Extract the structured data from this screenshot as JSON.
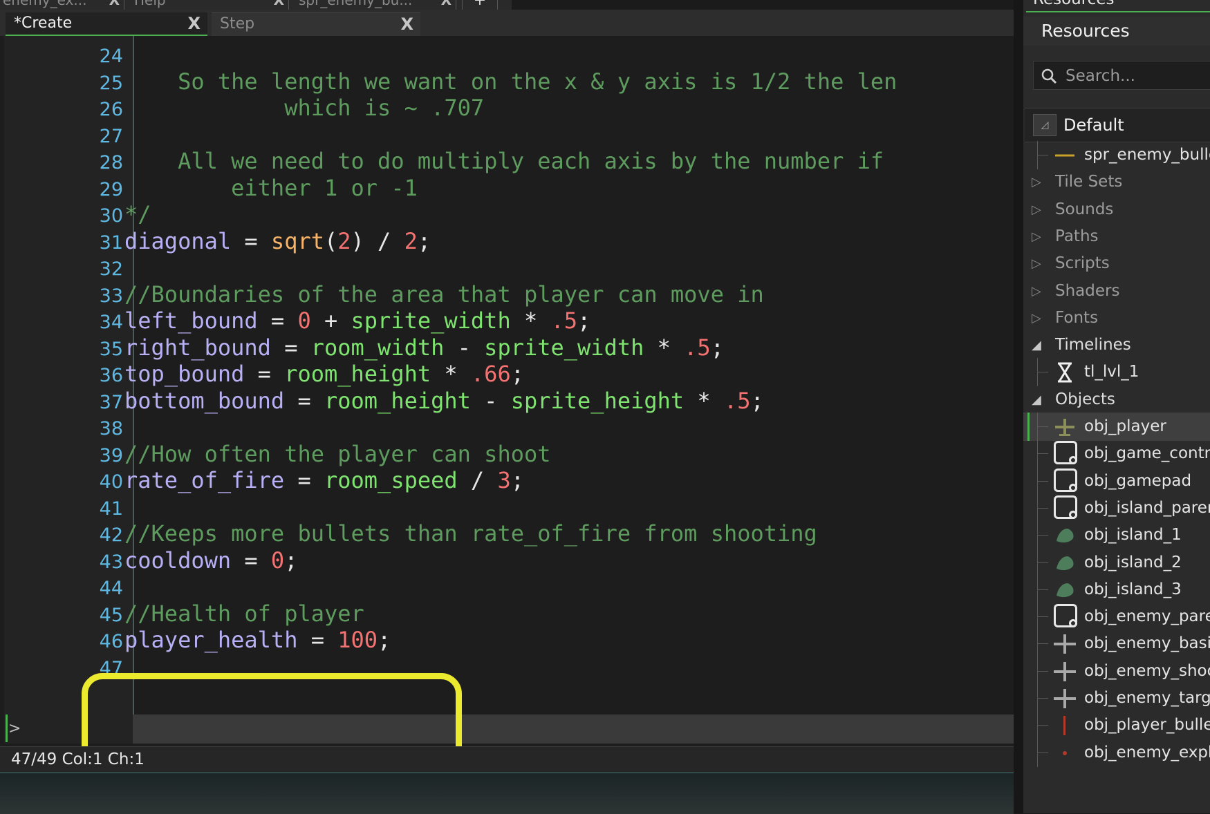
{
  "doc_tabs": [
    {
      "label": "enemy_ex...",
      "close": "X"
    },
    {
      "label": "Help",
      "close": "X"
    },
    {
      "label": "spr_enemy_bu...",
      "close": "X"
    }
  ],
  "add_tab": "+",
  "event_tabs": [
    {
      "label": "*Create",
      "close": "X",
      "active": true
    },
    {
      "label": "Step",
      "close": "X",
      "active": false
    }
  ],
  "editor": {
    "lines": [
      {
        "n": "24",
        "text": ""
      },
      {
        "n": "25",
        "text": "    So the length we want on the x & y axis is 1/2 the len"
      },
      {
        "n": "26",
        "text": "            which is ~ .707"
      },
      {
        "n": "27",
        "text": ""
      },
      {
        "n": "28",
        "text": "    All we need to do multiply each axis by the number if"
      },
      {
        "n": "29",
        "text": "        either 1 or -1"
      },
      {
        "n": "30",
        "text": "*/"
      },
      {
        "n": "31",
        "text": "diagonal = sqrt(2) / 2;"
      },
      {
        "n": "32",
        "text": ""
      },
      {
        "n": "33",
        "text": "//Boundaries of the area that player can move in"
      },
      {
        "n": "34",
        "text": "left_bound = 0 + sprite_width * .5;"
      },
      {
        "n": "35",
        "text": "right_bound = room_width - sprite_width * .5;"
      },
      {
        "n": "36",
        "text": "top_bound = room_height * .66;"
      },
      {
        "n": "37",
        "text": "bottom_bound = room_height - sprite_height * .5;"
      },
      {
        "n": "38",
        "text": ""
      },
      {
        "n": "39",
        "text": "//How often the player can shoot"
      },
      {
        "n": "40",
        "text": "rate_of_fire = room_speed / 3;"
      },
      {
        "n": "41",
        "text": ""
      },
      {
        "n": "42",
        "text": "//Keeps more bullets than rate_of_fire from shooting"
      },
      {
        "n": "43",
        "text": "cooldown = 0;"
      },
      {
        "n": "44",
        "text": ""
      },
      {
        "n": "45",
        "text": "//Health of player"
      },
      {
        "n": "46",
        "text": "player_health = 100;"
      },
      {
        "n": "47",
        "text": ""
      }
    ],
    "caret_marker": ">"
  },
  "status_bar": {
    "text": "47/49 Col:1 Ch:1"
  },
  "resources": {
    "top_tab": "Resources",
    "title": "Resources",
    "search_placeholder": "Search...",
    "filter": "Default",
    "tree": [
      {
        "type": "item",
        "label": "spr_enemy_bulle",
        "icon": "sprite-line-icon"
      },
      {
        "type": "group",
        "label": "Tile Sets",
        "open": false
      },
      {
        "type": "group",
        "label": "Sounds",
        "open": false
      },
      {
        "type": "group",
        "label": "Paths",
        "open": false
      },
      {
        "type": "group",
        "label": "Scripts",
        "open": false
      },
      {
        "type": "group",
        "label": "Shaders",
        "open": false
      },
      {
        "type": "group",
        "label": "Fonts",
        "open": false
      },
      {
        "type": "group",
        "label": "Timelines",
        "open": true
      },
      {
        "type": "item",
        "label": "tl_lvl_1",
        "icon": "hourglass-icon"
      },
      {
        "type": "group",
        "label": "Objects",
        "open": true
      },
      {
        "type": "item",
        "label": "obj_player",
        "icon": "plane-sprite-icon",
        "selected": true
      },
      {
        "type": "item",
        "label": "obj_game_contro",
        "icon": "object-icon"
      },
      {
        "type": "item",
        "label": "obj_gamepad",
        "icon": "object-icon"
      },
      {
        "type": "item",
        "label": "obj_island_parer",
        "icon": "object-icon"
      },
      {
        "type": "item",
        "label": "obj_island_1",
        "icon": "island-sprite-icon"
      },
      {
        "type": "item",
        "label": "obj_island_2",
        "icon": "island-sprite-icon"
      },
      {
        "type": "item",
        "label": "obj_island_3",
        "icon": "island-sprite-icon"
      },
      {
        "type": "item",
        "label": "obj_enemy_pare",
        "icon": "object-icon"
      },
      {
        "type": "item",
        "label": "obj_enemy_basic",
        "icon": "enemy-sprite-icon"
      },
      {
        "type": "item",
        "label": "obj_enemy_shoo",
        "icon": "enemy-sprite-icon"
      },
      {
        "type": "item",
        "label": "obj_enemy_targe",
        "icon": "enemy-sprite-icon"
      },
      {
        "type": "item",
        "label": "obj_player_bulle",
        "icon": "bullet-sprite-icon"
      },
      {
        "type": "item",
        "label": "obj_enemy_expl",
        "icon": "explosion-sprite-icon"
      }
    ]
  },
  "colors": {
    "comment": "#5e9b5e",
    "variable": "#b8b0f4",
    "number": "#f47272",
    "function": "#f7b469",
    "builtin": "#7ee36f",
    "line_number": "#5fb8e2",
    "highlight_box": "#ecea2f",
    "accent": "#4caf50"
  }
}
